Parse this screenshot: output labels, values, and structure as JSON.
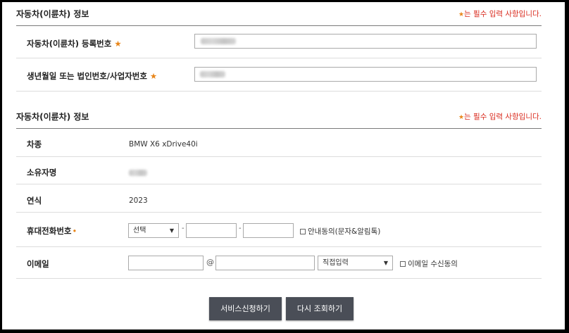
{
  "registration_section": {
    "title": "자동차(이륜차) 정보",
    "required_note": "는 필수 입력 사항입니다.",
    "required_star": "★",
    "fields": {
      "reg_number_label": "자동차(이륜차) 등록번호",
      "birth_label": "생년월일 또는 법인번호/사업자번호",
      "star": "★"
    }
  },
  "vehicle_section": {
    "title": "자동차(이륜차) 정보",
    "required_note": "는 필수 입력 사항입니다.",
    "required_star": "★",
    "rows": {
      "car_type_label": "차종",
      "car_type_value": "BMW X6 xDrive40i",
      "owner_label": "소유자명",
      "year_label": "연식",
      "year_value": "2023",
      "phone_label": "휴대전화번호",
      "phone_star": "•",
      "phone_select": "선택",
      "phone_dash": "-",
      "phone_consent": "안내동의(문자&알림톡)",
      "email_label": "이메일",
      "email_at": "@",
      "email_domain_select": "직접입력",
      "email_consent": "이메일 수신동의"
    }
  },
  "buttons": {
    "apply": "서비스신청하기",
    "retry": "다시 조회하기"
  },
  "colors": {
    "required_text": "#d9291c",
    "required_star": "#e8861a",
    "button_bg": "#4a4e57"
  },
  "icons": {
    "select_arrow": "▼"
  }
}
